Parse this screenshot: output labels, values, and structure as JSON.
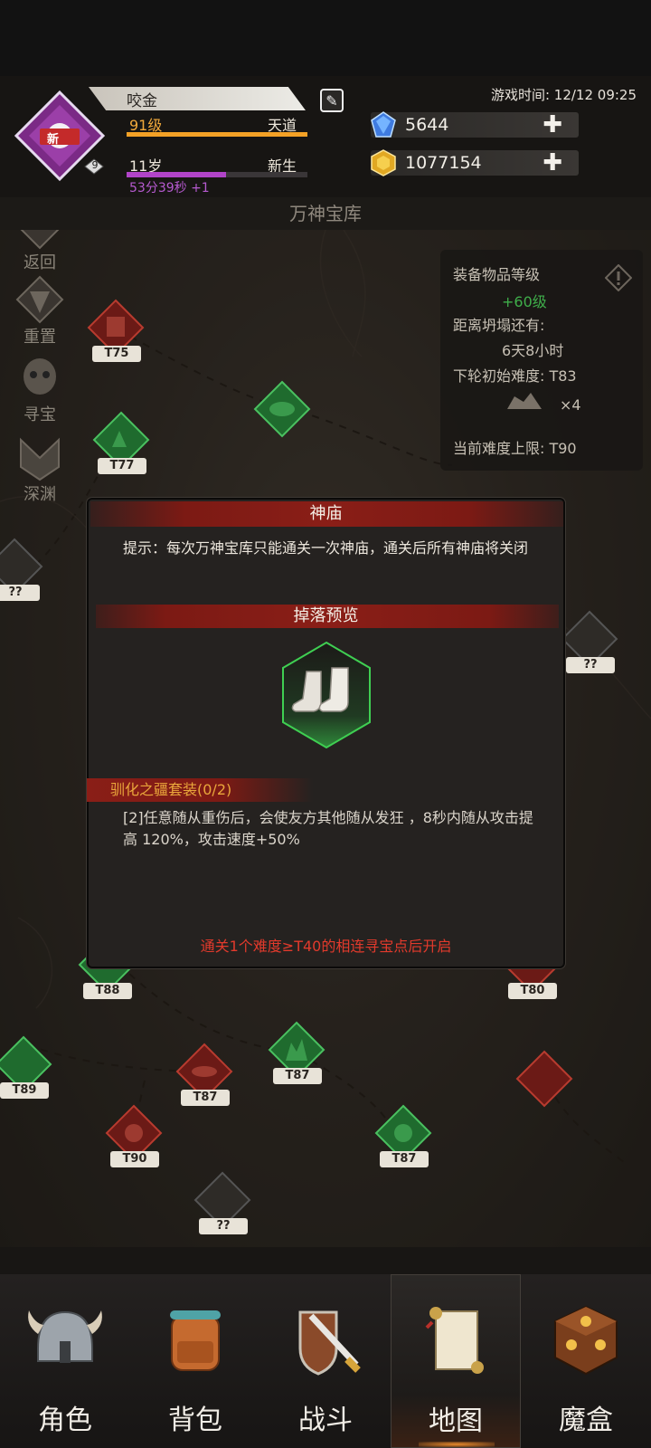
{
  "header": {
    "player_name": "咬金",
    "level": "91级",
    "realm": "天道",
    "age": "11岁",
    "state": "新生",
    "age_progress": 0.55,
    "timer": "53分39秒 +1",
    "avatar_badge": "新",
    "avatar_level": "9",
    "game_time": "游戏时间: 12/12 09:25",
    "diamonds": "5644",
    "gold": "1077154"
  },
  "page_title": "万神宝库",
  "side_menu": [
    {
      "label": "返回"
    },
    {
      "label": "重置"
    },
    {
      "label": "寻宝"
    },
    {
      "label": "深渊"
    }
  ],
  "info_panel": {
    "title": "装备物品等级",
    "bonus": "+60级",
    "collapse_label": "距离坍塌还有:",
    "collapse_time": "6天8小时",
    "next_difficulty": "下轮初始难度: T83",
    "reward_count": "×4",
    "max_difficulty": "当前难度上限: T90"
  },
  "map_nodes": [
    {
      "tag": "T75"
    },
    {
      "tag": "T77"
    },
    {
      "tag": "??"
    },
    {
      "tag": "T88"
    },
    {
      "tag": "T80"
    },
    {
      "tag": "T87"
    },
    {
      "tag": "T89"
    },
    {
      "tag": "T87"
    },
    {
      "tag": "T90"
    },
    {
      "tag": "T87"
    },
    {
      "tag": "??"
    },
    {
      "tag": "??"
    }
  ],
  "modal": {
    "title": "神庙",
    "tip": "提示：每次万神宝库只能通关一次神庙，通关后所有神庙将关闭",
    "drop_title": "掉落预览",
    "set_title": "驯化之疆套装(0/2)",
    "set_desc": "[2]任意随从重伤后，会使友方其他随从发狂 ，8秒内随从攻击提高 120%，攻击速度+50%",
    "unlock_text": "通关1个难度≥T40的相连寻宝点后开启"
  },
  "tabs": [
    {
      "label": "角色",
      "icon": "helmet-icon"
    },
    {
      "label": "背包",
      "icon": "backpack-icon"
    },
    {
      "label": "战斗",
      "icon": "sword-shield-icon"
    },
    {
      "label": "地图",
      "icon": "map-scroll-icon"
    },
    {
      "label": "魔盒",
      "icon": "magic-box-icon"
    }
  ],
  "colors": {
    "accent_orange": "#f3a126",
    "age_purple": "#b144c8",
    "modal_red": "#8a1e17",
    "unlock_red": "#e23a2c",
    "node_green": "#1f6b2e",
    "node_red": "#6b1a16"
  }
}
